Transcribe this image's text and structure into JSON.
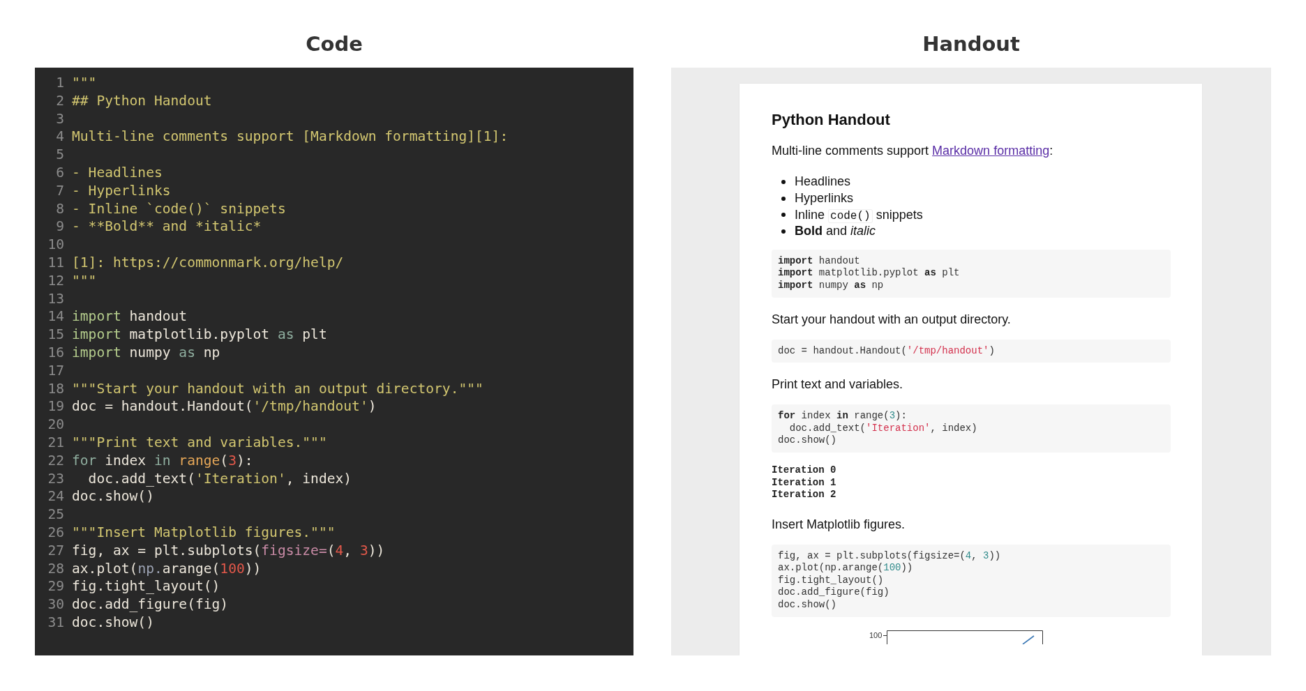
{
  "code_panel": {
    "title": "Code",
    "lines": [
      {
        "number": "1",
        "tokens": [
          {
            "text": "\"\"\"",
            "kind": "comment"
          }
        ]
      },
      {
        "number": "2",
        "tokens": [
          {
            "text": "## Python Handout",
            "kind": "comment"
          }
        ]
      },
      {
        "number": "3"
      },
      {
        "number": "4",
        "tokens": [
          {
            "text": "Multi-line comments support [Markdown formatting][1]:",
            "kind": "comment"
          }
        ]
      },
      {
        "number": "5"
      },
      {
        "number": "6",
        "tokens": [
          {
            "text": "- Headlines",
            "kind": "comment"
          }
        ]
      },
      {
        "number": "7",
        "tokens": [
          {
            "text": "- Hyperlinks",
            "kind": "comment"
          }
        ]
      },
      {
        "number": "8",
        "tokens": [
          {
            "text": "- Inline `code()` snippets",
            "kind": "comment"
          }
        ]
      },
      {
        "number": "9",
        "tokens": [
          {
            "text": "- **Bold** and *italic*",
            "kind": "comment"
          }
        ]
      },
      {
        "number": "10"
      },
      {
        "number": "11",
        "tokens": [
          {
            "text": "[1]: https://commonmark.org/help/",
            "kind": "comment"
          }
        ]
      },
      {
        "number": "12",
        "tokens": [
          {
            "text": "\"\"\"",
            "kind": "comment"
          }
        ]
      },
      {
        "number": "13"
      },
      {
        "number": "14",
        "tokens": [
          {
            "text": "import",
            "kind": "keyword"
          },
          {
            "text": " handout",
            "kind": "plain"
          }
        ]
      },
      {
        "number": "15",
        "tokens": [
          {
            "text": "import",
            "kind": "keyword"
          },
          {
            "text": " matplotlib.pyplot ",
            "kind": "plain"
          },
          {
            "text": "as",
            "kind": "operator"
          },
          {
            "text": " plt",
            "kind": "plain"
          }
        ]
      },
      {
        "number": "16",
        "tokens": [
          {
            "text": "import",
            "kind": "keyword"
          },
          {
            "text": " numpy ",
            "kind": "plain"
          },
          {
            "text": "as",
            "kind": "operator"
          },
          {
            "text": " np",
            "kind": "plain"
          }
        ]
      },
      {
        "number": "17"
      },
      {
        "number": "18",
        "tokens": [
          {
            "text": "\"\"\"Start your handout with an output directory.\"\"\"",
            "kind": "comment"
          }
        ]
      },
      {
        "number": "19",
        "tokens": [
          {
            "text": "doc = handout.Handout(",
            "kind": "plain"
          },
          {
            "text": "'/tmp/handout'",
            "kind": "string"
          },
          {
            "text": ")",
            "kind": "plain"
          }
        ]
      },
      {
        "number": "20"
      },
      {
        "number": "21",
        "tokens": [
          {
            "text": "\"\"\"Print text and variables.\"\"\"",
            "kind": "comment"
          }
        ]
      },
      {
        "number": "22",
        "tokens": [
          {
            "text": "for",
            "kind": "operator"
          },
          {
            "text": " index ",
            "kind": "plain"
          },
          {
            "text": "in",
            "kind": "operator"
          },
          {
            "text": " range",
            "kind": "builtin"
          },
          {
            "text": "(",
            "kind": "plain"
          },
          {
            "text": "3",
            "kind": "number"
          },
          {
            "text": "):",
            "kind": "plain"
          }
        ]
      },
      {
        "number": "23",
        "tokens": [
          {
            "text": "  doc.add_text(",
            "kind": "plain"
          },
          {
            "text": "'Iteration'",
            "kind": "string"
          },
          {
            "text": ", index)",
            "kind": "plain"
          }
        ]
      },
      {
        "number": "24",
        "tokens": [
          {
            "text": "doc.show()",
            "kind": "plain"
          }
        ]
      },
      {
        "number": "25"
      },
      {
        "number": "26",
        "tokens": [
          {
            "text": "\"\"\"Insert Matplotlib figures.\"\"\"",
            "kind": "comment"
          }
        ]
      },
      {
        "number": "27",
        "tokens": [
          {
            "text": "fig, ax = plt.subplots(",
            "kind": "plain"
          },
          {
            "text": "figsize=",
            "kind": "param"
          },
          {
            "text": "(",
            "kind": "plain"
          },
          {
            "text": "4",
            "kind": "number"
          },
          {
            "text": ", ",
            "kind": "plain"
          },
          {
            "text": "3",
            "kind": "number"
          },
          {
            "text": "))",
            "kind": "plain"
          }
        ]
      },
      {
        "number": "28",
        "tokens": [
          {
            "text": "ax.plot(",
            "kind": "plain"
          },
          {
            "text": "np.",
            "kind": "module"
          },
          {
            "text": "arange(",
            "kind": "plain"
          },
          {
            "text": "100",
            "kind": "number"
          },
          {
            "text": "))",
            "kind": "plain"
          }
        ]
      },
      {
        "number": "29",
        "tokens": [
          {
            "text": "fig.tight_layout()",
            "kind": "plain"
          }
        ]
      },
      {
        "number": "30",
        "tokens": [
          {
            "text": "doc.add_figure(fig)",
            "kind": "plain"
          }
        ]
      },
      {
        "number": "31",
        "tokens": [
          {
            "text": "doc.show()",
            "kind": "plain"
          }
        ]
      }
    ]
  },
  "handout_panel": {
    "title": "Handout",
    "heading": "Python Handout",
    "intro": {
      "before": "Multi-line comments support ",
      "link": "Markdown formatting",
      "after": ":"
    },
    "bullets": [
      {
        "parts": [
          {
            "text": "Headlines",
            "kind": "text"
          }
        ]
      },
      {
        "parts": [
          {
            "text": "Hyperlinks",
            "kind": "text"
          }
        ]
      },
      {
        "parts": [
          {
            "text": "Inline ",
            "kind": "text"
          },
          {
            "text": "code()",
            "kind": "code"
          },
          {
            "text": " snippets",
            "kind": "text"
          }
        ]
      },
      {
        "parts": [
          {
            "text": "Bold",
            "kind": "bold"
          },
          {
            "text": " and ",
            "kind": "text"
          },
          {
            "text": "italic",
            "kind": "italic"
          }
        ]
      }
    ],
    "blocks": [
      {
        "kind": "code",
        "lines": [
          [
            {
              "text": "import",
              "kind": "keyword"
            },
            {
              "text": " handout",
              "kind": "plain"
            }
          ],
          [
            {
              "text": "import",
              "kind": "keyword"
            },
            {
              "text": " matplotlib.pyplot ",
              "kind": "plain"
            },
            {
              "text": "as",
              "kind": "keyword"
            },
            {
              "text": " plt",
              "kind": "plain"
            }
          ],
          [
            {
              "text": "import",
              "kind": "keyword"
            },
            {
              "text": " numpy ",
              "kind": "plain"
            },
            {
              "text": "as",
              "kind": "keyword"
            },
            {
              "text": " np",
              "kind": "plain"
            }
          ]
        ]
      },
      {
        "kind": "paragraph",
        "text": "Start your handout with an output directory."
      },
      {
        "kind": "code",
        "lines": [
          [
            {
              "text": "doc = handout.Handout(",
              "kind": "plain"
            },
            {
              "text": "'/tmp/handout'",
              "kind": "string"
            },
            {
              "text": ")",
              "kind": "plain"
            }
          ]
        ]
      },
      {
        "kind": "paragraph",
        "text": "Print text and variables."
      },
      {
        "kind": "code",
        "lines": [
          [
            {
              "text": "for",
              "kind": "keyword"
            },
            {
              "text": " index ",
              "kind": "plain"
            },
            {
              "text": "in",
              "kind": "keyword"
            },
            {
              "text": " range(",
              "kind": "plain"
            },
            {
              "text": "3",
              "kind": "number"
            },
            {
              "text": "):",
              "kind": "plain"
            }
          ],
          [
            {
              "text": "  doc.add_text(",
              "kind": "plain"
            },
            {
              "text": "'Iteration'",
              "kind": "string"
            },
            {
              "text": ", index)",
              "kind": "plain"
            }
          ],
          [
            {
              "text": "doc.show()",
              "kind": "plain"
            }
          ]
        ]
      },
      {
        "kind": "output",
        "lines": [
          "Iteration 0",
          "Iteration 1",
          "Iteration 2"
        ]
      },
      {
        "kind": "paragraph",
        "text": "Insert Matplotlib figures."
      },
      {
        "kind": "code",
        "lines": [
          [
            {
              "text": "fig, ax = plt.subplots(figsize=(",
              "kind": "plain"
            },
            {
              "text": "4",
              "kind": "number"
            },
            {
              "text": ", ",
              "kind": "plain"
            },
            {
              "text": "3",
              "kind": "number"
            },
            {
              "text": "))",
              "kind": "plain"
            }
          ],
          [
            {
              "text": "ax.plot(np.arange(",
              "kind": "plain"
            },
            {
              "text": "100",
              "kind": "number"
            },
            {
              "text": "))",
              "kind": "plain"
            }
          ],
          [
            {
              "text": "fig.tight_layout()",
              "kind": "plain"
            }
          ],
          [
            {
              "text": "doc.add_figure(fig)",
              "kind": "plain"
            }
          ],
          [
            {
              "text": "doc.show()",
              "kind": "plain"
            }
          ]
        ]
      },
      {
        "kind": "figure",
        "tick_label": "100"
      }
    ]
  }
}
